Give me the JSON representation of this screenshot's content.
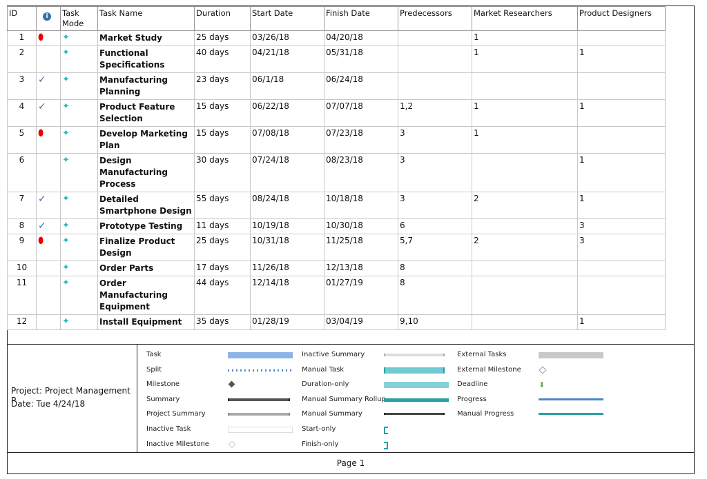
{
  "headers": {
    "id": "ID",
    "indicators": "i",
    "mode": "Task Mode",
    "name": "Task Name",
    "duration": "Duration",
    "start": "Start Date",
    "finish": "Finish Date",
    "pred": "Predecessors",
    "mr": "Market Researchers",
    "pd": "Product Designers"
  },
  "tasks": [
    {
      "id": "1",
      "ind": "pin",
      "name": "Market Study",
      "duration": "25 days",
      "start": "03/26/18",
      "finish": "04/20/18",
      "pred": "",
      "mr": "1",
      "pd": ""
    },
    {
      "id": "2",
      "ind": "",
      "name": "Functional Specifications",
      "duration": "40 days",
      "start": "04/21/18",
      "finish": "05/31/18",
      "pred": "",
      "mr": "1",
      "pd": "1"
    },
    {
      "id": "3",
      "ind": "check",
      "name": "Manufacturing Planning",
      "duration": "23 days",
      "start": "06/1/18",
      "finish": "06/24/18",
      "pred": "",
      "mr": "",
      "pd": ""
    },
    {
      "id": "4",
      "ind": "check",
      "name": "Product Feature Selection",
      "duration": "15 days",
      "start": "06/22/18",
      "finish": "07/07/18",
      "pred": "1,2",
      "mr": "1",
      "pd": "1"
    },
    {
      "id": "5",
      "ind": "pin",
      "name": "Develop Marketing Plan",
      "duration": "15 days",
      "start": "07/08/18",
      "finish": "07/23/18",
      "pred": "3",
      "mr": "1",
      "pd": ""
    },
    {
      "id": "6",
      "ind": "",
      "name": "Design Manufacturing Process",
      "duration": "30 days",
      "start": "07/24/18",
      "finish": "08/23/18",
      "pred": "3",
      "mr": "",
      "pd": "1"
    },
    {
      "id": "7",
      "ind": "check",
      "name": "Detailed Smartphone Design",
      "duration": "55 days",
      "start": "08/24/18",
      "finish": "10/18/18",
      "pred": "3",
      "mr": "2",
      "pd": "1"
    },
    {
      "id": "8",
      "ind": "check",
      "name": "Prototype Testing",
      "duration": "11 days",
      "start": "10/19/18",
      "finish": "10/30/18",
      "pred": "6",
      "mr": "",
      "pd": "3"
    },
    {
      "id": "9",
      "ind": "pin",
      "name": "Finalize Product Design",
      "duration": "25 days",
      "start": "10/31/18",
      "finish": "11/25/18",
      "pred": "5,7",
      "mr": "2",
      "pd": "3"
    },
    {
      "id": "10",
      "ind": "",
      "name": "Order Parts",
      "duration": "17 days",
      "start": "11/26/18",
      "finish": "12/13/18",
      "pred": "8",
      "mr": "",
      "pd": ""
    },
    {
      "id": "11",
      "ind": "",
      "name": "Order Manufacturing Equipment",
      "duration": "44 days",
      "start": "12/14/18",
      "finish": "01/27/19",
      "pred": "8",
      "mr": "",
      "pd": ""
    },
    {
      "id": "12",
      "ind": "",
      "name": "Install Equipment",
      "duration": "35 days",
      "start": "01/28/19",
      "finish": "03/04/19",
      "pred": "9,10",
      "mr": "",
      "pd": "1"
    }
  ],
  "footer": {
    "project": "Project: Project Management P",
    "date": "Date: Tue 4/24/18",
    "page": "Page 1"
  },
  "legend": [
    {
      "label": "Task",
      "sw": "task"
    },
    {
      "label": "Split",
      "sw": "split"
    },
    {
      "label": "Milestone",
      "sw": "milestone"
    },
    {
      "label": "Summary",
      "sw": "summary"
    },
    {
      "label": "Project Summary",
      "sw": "projsum"
    },
    {
      "label": "Inactive Task",
      "sw": "inactive"
    },
    {
      "label": "Inactive Milestone",
      "sw": "inmile"
    },
    {
      "label": "Inactive Summary",
      "sw": "insum"
    },
    {
      "label": "Manual Task",
      "sw": "manual"
    },
    {
      "label": "Duration-only",
      "sw": "duronly"
    },
    {
      "label": "Manual Summary Rollup",
      "sw": "rollup"
    },
    {
      "label": "Manual Summary",
      "sw": "mansum"
    },
    {
      "label": "Start-only",
      "sw": "startonly"
    },
    {
      "label": "Finish-only",
      "sw": "finonly"
    },
    {
      "label": "External Tasks",
      "sw": "ext"
    },
    {
      "label": "External Milestone",
      "sw": "extmile"
    },
    {
      "label": "Deadline",
      "sw": "deadline"
    },
    {
      "label": "Progress",
      "sw": "progress"
    },
    {
      "label": "Manual Progress",
      "sw": "manprog"
    }
  ],
  "colors": {
    "task": "#8cb4e6",
    "manual": "#6fcad2",
    "teal": "#2aa0a8",
    "progress": "#4a86c5"
  }
}
